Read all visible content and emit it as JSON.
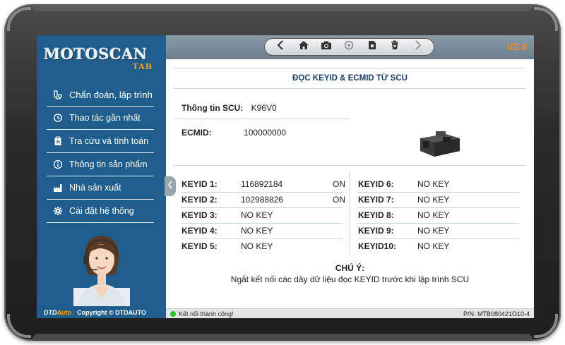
{
  "app": {
    "logo_main": "MOTOSCAN",
    "logo_sub": "TAB",
    "version": "V2.6"
  },
  "sidebar": {
    "items": [
      {
        "label": "Chẩn đoán, lập trình",
        "icon": "diagnostic-icon"
      },
      {
        "label": "Thao tác gần nhất",
        "icon": "history-icon"
      },
      {
        "label": "Tra cứu và tính toán",
        "icon": "clipboard-icon"
      },
      {
        "label": "Thông tin sản phẩm",
        "icon": "info-icon"
      },
      {
        "label": "Nhà sản xuất",
        "icon": "factory-icon"
      },
      {
        "label": "Cài đặt hệ thống",
        "icon": "gear-icon"
      }
    ],
    "footer_logo_a": "DTD",
    "footer_logo_b": "Auto",
    "copyright": "Copyright © DTDAUTO"
  },
  "toolbar": {
    "buttons": [
      "back-icon",
      "home-icon",
      "camera-icon",
      "record-icon",
      "file-icon",
      "delete-icon",
      "forward-icon"
    ]
  },
  "main": {
    "title": "ĐỌC KEYID & ECMID TỪ SCU",
    "scu_label": "Thông tin SCU:",
    "scu_value": "K96V0",
    "ecmid_label": "ECMID:",
    "ecmid_value": "100000000",
    "keys_left": [
      {
        "label": "KEYID 1:",
        "value": "116892184",
        "status": "ON"
      },
      {
        "label": "KEYID 2:",
        "value": "102988826",
        "status": "ON"
      },
      {
        "label": "KEYID 3:",
        "value": "NO KEY",
        "status": ""
      },
      {
        "label": "KEYID 4:",
        "value": "NO KEY",
        "status": ""
      },
      {
        "label": "KEYID 5:",
        "value": "NO KEY",
        "status": ""
      }
    ],
    "keys_right": [
      {
        "label": "KEYID 6:",
        "value": "NO KEY"
      },
      {
        "label": "KEYID 7:",
        "value": "NO KEY"
      },
      {
        "label": "KEYID 8:",
        "value": "NO KEY"
      },
      {
        "label": "KEYID 9:",
        "value": "NO KEY"
      },
      {
        "label": "KEYID10:",
        "value": "NO KEY"
      }
    ],
    "note_title": "CHÚ Ý:",
    "note_text": "Ngắt kết nối các dây dữ liệu đọc KEYID trước khi lập trình SCU"
  },
  "status": {
    "connection": "Kết nối thành công!",
    "part_number": "P/N: MTB080421O10-4",
    "connection_color": "#2ec22e"
  },
  "colors": {
    "sidebar": "#1e5d8c",
    "accent": "#f08a1c",
    "title": "#1c3e66"
  }
}
